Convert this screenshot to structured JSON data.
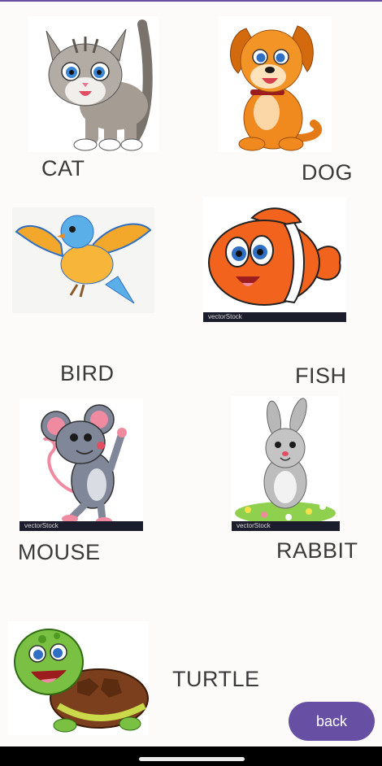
{
  "animals": {
    "cat": "CAT",
    "dog": "DOG",
    "bird": "BIRD",
    "fish": "FISH",
    "mouse": "MOUSE",
    "rabbit": "RABBIT",
    "turtle": "TURTLE"
  },
  "stock_watermark": "vectorStock",
  "actions": {
    "back_label": "back"
  },
  "colors": {
    "accent": "#6750a4",
    "label_text": "#3a3a3a",
    "background": "#fdfbfa"
  }
}
